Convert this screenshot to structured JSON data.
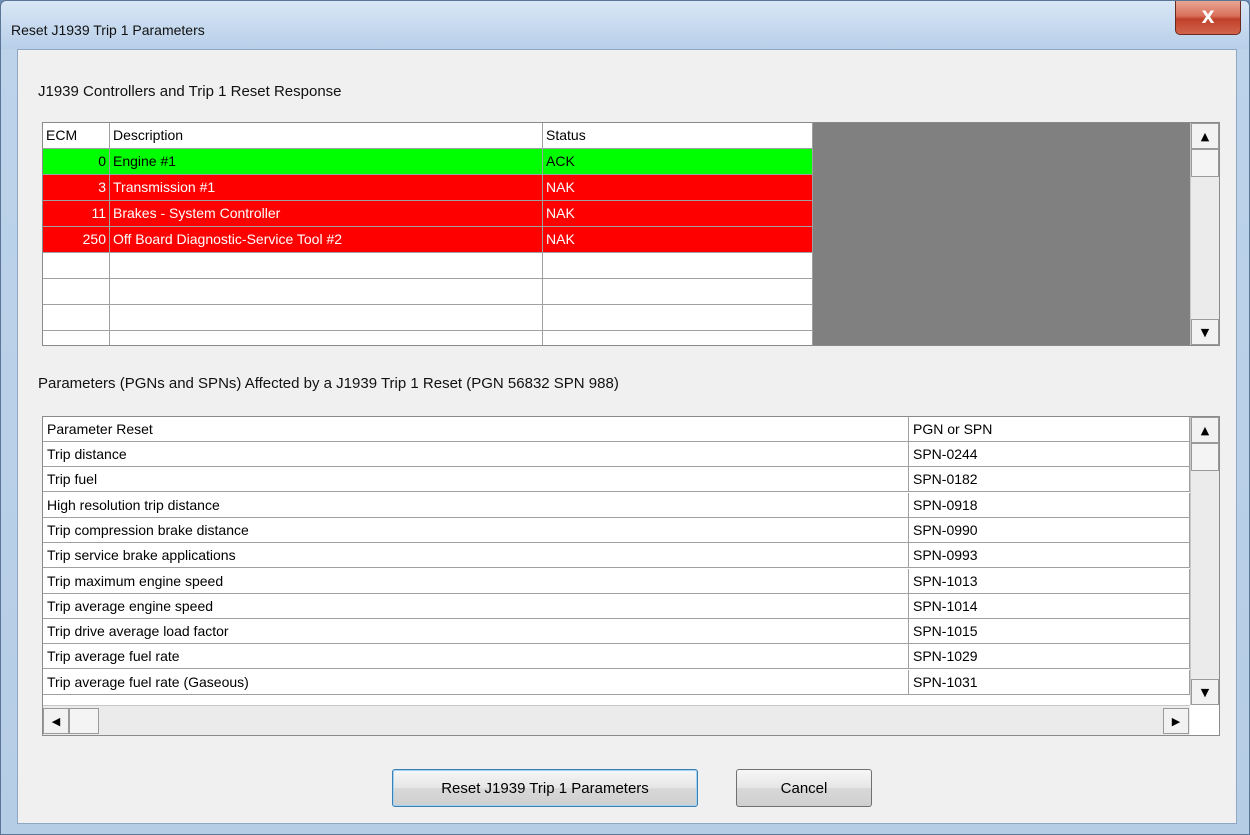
{
  "window": {
    "title": "Reset J1939 Trip 1 Parameters",
    "close_glyph": "X"
  },
  "controllers": {
    "label": "J1939 Controllers and Trip 1 Reset Response",
    "columns": [
      "ECM",
      "Description",
      "Status"
    ],
    "rows": [
      {
        "ecm": "0",
        "description": "Engine #1",
        "status": "ACK",
        "color": "#00ff00"
      },
      {
        "ecm": "3",
        "description": "Transmission #1",
        "status": "NAK",
        "color": "#ff0000"
      },
      {
        "ecm": "11",
        "description": "Brakes - System Controller",
        "status": "NAK",
        "color": "#ff0000"
      },
      {
        "ecm": "250",
        "description": "Off Board Diagnostic-Service Tool #2",
        "status": "NAK",
        "color": "#ff0000"
      }
    ],
    "empty_rows": 4
  },
  "parameters": {
    "label": "Parameters (PGNs and SPNs) Affected by a J1939 Trip 1 Reset (PGN 56832 SPN 988)",
    "columns": [
      "Parameter Reset",
      "PGN or SPN"
    ],
    "rows": [
      {
        "name": "Trip distance",
        "id": "SPN-0244"
      },
      {
        "name": "Trip fuel",
        "id": "SPN-0182"
      },
      {
        "name": "High resolution trip distance",
        "id": "SPN-0918"
      },
      {
        "name": "Trip compression brake distance",
        "id": "SPN-0990"
      },
      {
        "name": "Trip service brake applications",
        "id": "SPN-0993"
      },
      {
        "name": "Trip maximum engine speed",
        "id": "SPN-1013"
      },
      {
        "name": "Trip average engine speed",
        "id": "SPN-1014"
      },
      {
        "name": "Trip drive average load factor",
        "id": "SPN-1015"
      },
      {
        "name": "Trip average fuel rate",
        "id": "SPN-1029"
      },
      {
        "name": "Trip average fuel rate (Gaseous)",
        "id": "SPN-1031"
      }
    ]
  },
  "buttons": {
    "reset": "Reset J1939 Trip 1 Parameters",
    "cancel": "Cancel"
  },
  "icons": {
    "up": "▲",
    "down": "▼",
    "left": "◀",
    "right": "▶"
  }
}
